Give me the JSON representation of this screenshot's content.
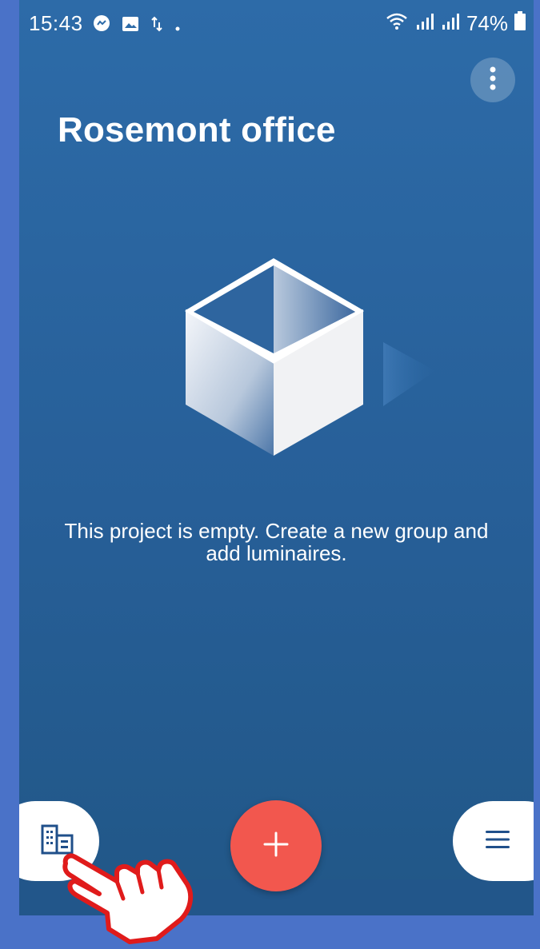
{
  "status_bar": {
    "time": "15:43",
    "battery": "74%",
    "icons": [
      "messenger-icon",
      "image-icon",
      "data-transfer-icon",
      "dot-icon",
      "wifi-icon",
      "signal-icon",
      "signal-icon",
      "battery-icon"
    ]
  },
  "header": {
    "title": "Rosemont office",
    "overflow_menu_icon": "more-vertical-icon"
  },
  "empty_state": {
    "illustration": "open-box-icon",
    "message": "This project is empty. Create a new group and add luminaires."
  },
  "bottom_nav": {
    "left_icon": "building-icon",
    "fab_icon": "plus-icon",
    "right_icon": "hamburger-menu-icon"
  },
  "overlay": {
    "pointer_icon": "pointing-hand-icon"
  },
  "colors": {
    "background_top": "#2d6ba8",
    "background_bottom": "#215787",
    "fab": "#f2574e",
    "frame": "#4a72c8",
    "text": "#ffffff",
    "nav_icon": "#1f4f8a"
  }
}
